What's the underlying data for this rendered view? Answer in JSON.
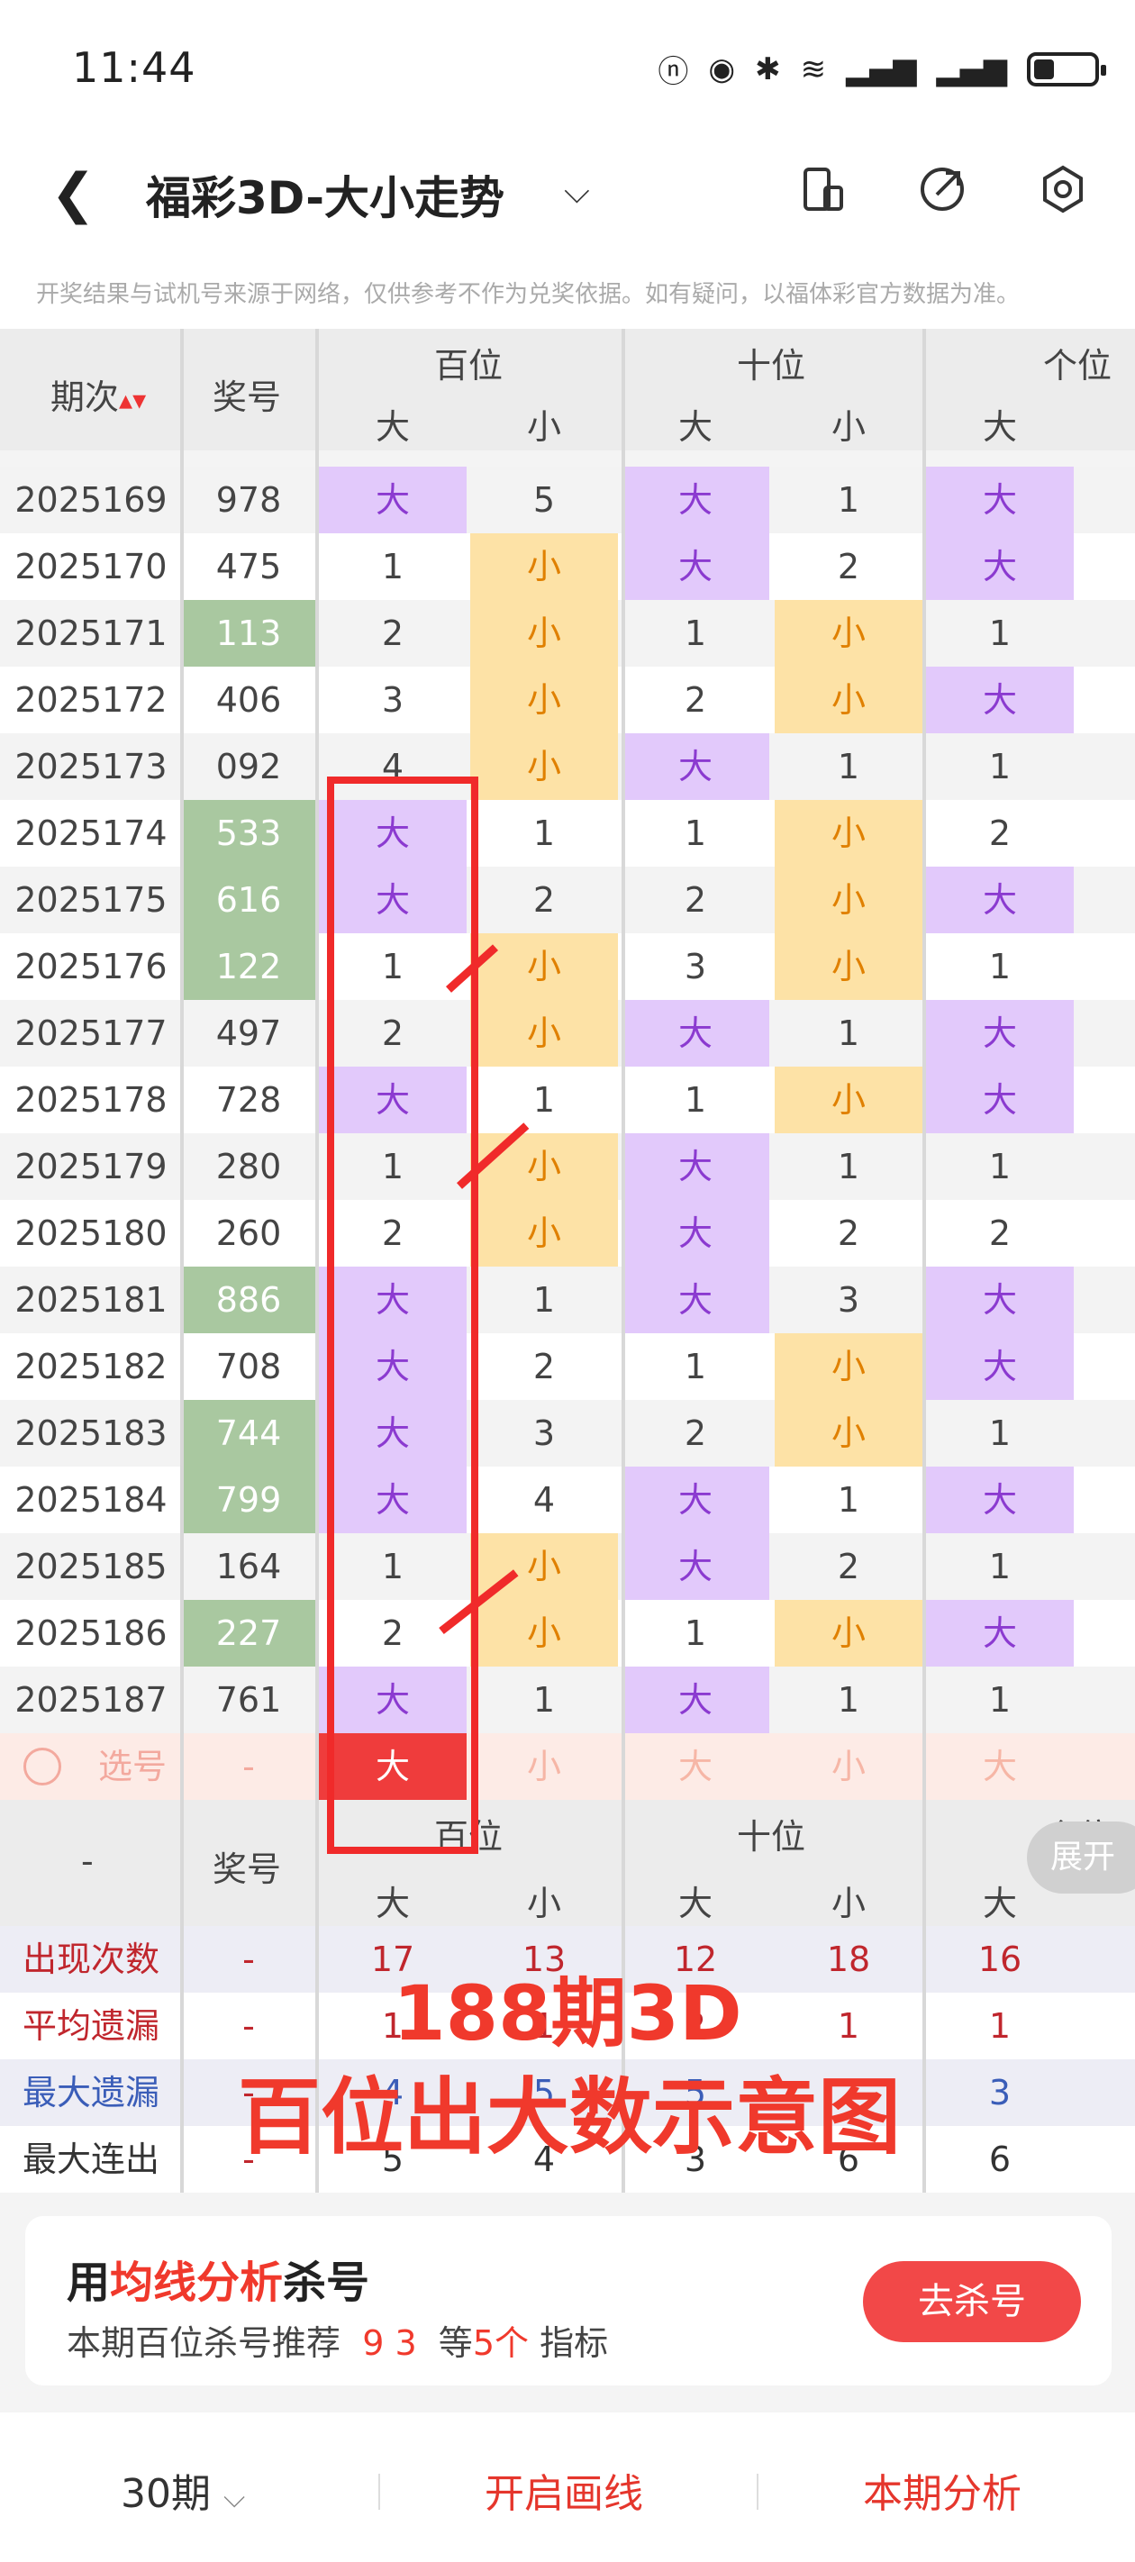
{
  "status_bar": {
    "time": "11:44",
    "battery_percent": 35
  },
  "nav": {
    "title": "福彩3D-大小走势"
  },
  "notice": "开奖结果与试机号来源于网络，仅供参考不作为兑奖依据。如有疑问，以福体彩官方数据为准。",
  "table": {
    "header": {
      "issue": "期次",
      "number": "奖号",
      "groups": [
        "百位",
        "十位",
        "个位"
      ],
      "big": "大",
      "small": "小"
    },
    "rows": [
      {
        "issue": "2025169",
        "num": "978",
        "hit": false,
        "v": [
          "大",
          "5",
          "大",
          "1",
          "大"
        ],
        "t": [
          "B",
          "n",
          "B",
          "n",
          "B"
        ],
        "alt": true
      },
      {
        "issue": "2025170",
        "num": "475",
        "hit": false,
        "v": [
          "1",
          "小",
          "大",
          "2",
          "大"
        ],
        "t": [
          "n",
          "S",
          "B",
          "n",
          "B"
        ],
        "alt": false
      },
      {
        "issue": "2025171",
        "num": "113",
        "hit": true,
        "v": [
          "2",
          "小",
          "1",
          "小",
          "1"
        ],
        "t": [
          "n",
          "S",
          "n",
          "S",
          "n"
        ],
        "alt": true
      },
      {
        "issue": "2025172",
        "num": "406",
        "hit": false,
        "v": [
          "3",
          "小",
          "2",
          "小",
          "大"
        ],
        "t": [
          "n",
          "S",
          "n",
          "S",
          "B"
        ],
        "alt": false
      },
      {
        "issue": "2025173",
        "num": "092",
        "hit": false,
        "v": [
          "4",
          "小",
          "大",
          "1",
          "1"
        ],
        "t": [
          "n",
          "S",
          "B",
          "n",
          "n"
        ],
        "alt": true
      },
      {
        "issue": "2025174",
        "num": "533",
        "hit": true,
        "v": [
          "大",
          "1",
          "1",
          "小",
          "2"
        ],
        "t": [
          "B",
          "n",
          "n",
          "S",
          "n"
        ],
        "alt": false
      },
      {
        "issue": "2025175",
        "num": "616",
        "hit": true,
        "v": [
          "大",
          "2",
          "2",
          "小",
          "大"
        ],
        "t": [
          "B",
          "n",
          "n",
          "S",
          "B"
        ],
        "alt": true
      },
      {
        "issue": "2025176",
        "num": "122",
        "hit": true,
        "v": [
          "1",
          "小",
          "3",
          "小",
          "1"
        ],
        "t": [
          "n",
          "S",
          "n",
          "S",
          "n"
        ],
        "alt": false
      },
      {
        "issue": "2025177",
        "num": "497",
        "hit": false,
        "v": [
          "2",
          "小",
          "大",
          "1",
          "大"
        ],
        "t": [
          "n",
          "S",
          "B",
          "n",
          "B"
        ],
        "alt": true
      },
      {
        "issue": "2025178",
        "num": "728",
        "hit": false,
        "v": [
          "大",
          "1",
          "1",
          "小",
          "大"
        ],
        "t": [
          "B",
          "n",
          "n",
          "S",
          "B"
        ],
        "alt": false
      },
      {
        "issue": "2025179",
        "num": "280",
        "hit": false,
        "v": [
          "1",
          "小",
          "大",
          "1",
          "1"
        ],
        "t": [
          "n",
          "S",
          "B",
          "n",
          "n"
        ],
        "alt": true
      },
      {
        "issue": "2025180",
        "num": "260",
        "hit": false,
        "v": [
          "2",
          "小",
          "大",
          "2",
          "2"
        ],
        "t": [
          "n",
          "S",
          "B",
          "n",
          "n"
        ],
        "alt": false
      },
      {
        "issue": "2025181",
        "num": "886",
        "hit": true,
        "v": [
          "大",
          "1",
          "大",
          "3",
          "大"
        ],
        "t": [
          "B",
          "n",
          "B",
          "n",
          "B"
        ],
        "alt": true
      },
      {
        "issue": "2025182",
        "num": "708",
        "hit": false,
        "v": [
          "大",
          "2",
          "1",
          "小",
          "大"
        ],
        "t": [
          "B",
          "n",
          "n",
          "S",
          "B"
        ],
        "alt": false
      },
      {
        "issue": "2025183",
        "num": "744",
        "hit": true,
        "v": [
          "大",
          "3",
          "2",
          "小",
          "1"
        ],
        "t": [
          "B",
          "n",
          "n",
          "S",
          "n"
        ],
        "alt": true
      },
      {
        "issue": "2025184",
        "num": "799",
        "hit": true,
        "v": [
          "大",
          "4",
          "大",
          "1",
          "大"
        ],
        "t": [
          "B",
          "n",
          "B",
          "n",
          "B"
        ],
        "alt": false
      },
      {
        "issue": "2025185",
        "num": "164",
        "hit": false,
        "v": [
          "1",
          "小",
          "大",
          "2",
          "1"
        ],
        "t": [
          "n",
          "S",
          "B",
          "n",
          "n"
        ],
        "alt": true
      },
      {
        "issue": "2025186",
        "num": "227",
        "hit": true,
        "v": [
          "2",
          "小",
          "1",
          "小",
          "大"
        ],
        "t": [
          "n",
          "S",
          "n",
          "S",
          "B"
        ],
        "alt": false
      },
      {
        "issue": "2025187",
        "num": "761",
        "hit": false,
        "v": [
          "大",
          "1",
          "大",
          "1",
          "1"
        ],
        "t": [
          "B",
          "n",
          "B",
          "n",
          "n"
        ],
        "alt": true
      }
    ],
    "select_row": {
      "label": "选号",
      "num": "-",
      "v": [
        "大",
        "小",
        "大",
        "小",
        "大"
      ]
    },
    "footer_header": {
      "issue": "-",
      "number": "奖号",
      "groups": [
        "百位",
        "十位",
        "个位"
      ],
      "big": "大",
      "small": "小"
    },
    "stats": [
      {
        "label": "出现次数",
        "color": "#c0262d",
        "num": "-",
        "v": [
          "17",
          "13",
          "12",
          "18",
          "16"
        ],
        "vcolor": "#c0262d"
      },
      {
        "label": "平均遗漏",
        "color": "#c0262d",
        "num": "-",
        "v": [
          "1",
          "1",
          "2",
          "1",
          "1"
        ],
        "vcolor": "#c0262d"
      },
      {
        "label": "最大遗漏",
        "color": "#3a5db8",
        "num": "-",
        "v": [
          "4",
          "5",
          "5",
          "",
          "3"
        ],
        "vcolor": "#3a5db8"
      },
      {
        "label": "最大连出",
        "color": "#333333",
        "num": "-",
        "v": [
          "5",
          "4",
          "3",
          "6",
          "6"
        ],
        "vcolor": "#333333"
      }
    ],
    "expand_label": "展开"
  },
  "annotation": {
    "line1": "188期3D",
    "line2": "百位出大数示意图"
  },
  "promo": {
    "prefix": "用",
    "highlight": "均线分析",
    "suffix": "杀号",
    "sub_prefix": "本期百位杀号推荐",
    "sub_nums": "9 3",
    "sub_mid": "等",
    "sub_count": "5个",
    "sub_suffix": "指标",
    "button": "去杀号"
  },
  "footer": {
    "period": "30期",
    "draw_line": "开启画线",
    "analysis": "本期分析"
  }
}
